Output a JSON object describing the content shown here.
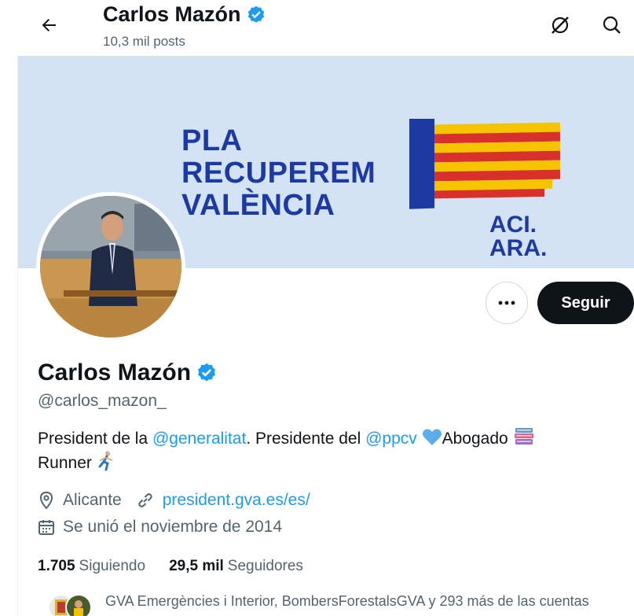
{
  "header": {
    "name": "Carlos Mazón",
    "posts": "10,3 mil posts"
  },
  "banner": {
    "lines": [
      "PLA",
      "RECUPEREM",
      "VALÈNCIA"
    ],
    "tagline": [
      "ACI.",
      "ARA."
    ],
    "colors": {
      "background": "#d3e3f3",
      "text": "#1d3aa3",
      "flag_red": "#d8312b",
      "flag_yellow": "#f5c400"
    }
  },
  "actions": {
    "more_label": "···",
    "follow_label": "Seguir"
  },
  "profile": {
    "name": "Carlos Mazón",
    "handle": "@carlos_mazon_",
    "bio": {
      "part1": "President de la ",
      "mention1": "@generalitat",
      "part2": ". Presidente del ",
      "mention2": "@ppcv",
      "part3": "Abogado",
      "part4": "Runner"
    },
    "location": "Alicante",
    "website": "president.gva.es/es/",
    "joined": "Se unió el noviembre de 2014"
  },
  "stats": {
    "following_count": "1.705",
    "following_label": "Siguiendo",
    "followers_count": "29,5 mil",
    "followers_label": "Seguidores"
  },
  "followed_by": {
    "text": "GVA Emergències i Interior, BombersForestalsGVA y 293 más de las cuentas"
  },
  "colors": {
    "accent": "#1d9bf0",
    "text": "#0f1419",
    "secondary": "#536471",
    "verified": "#1d9bf0"
  }
}
